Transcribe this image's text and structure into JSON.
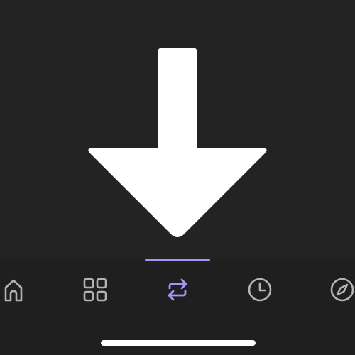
{
  "colors": {
    "background": "#232323",
    "tab_bar_background": "#1f1f1f",
    "accent": "#a596f5",
    "icon_inactive": "#b3b3b3",
    "hero_icon": "#ffffff"
  },
  "hero": {
    "icon": "download-arrow-icon"
  },
  "tab_bar": {
    "active_tab": "transfer",
    "tabs": [
      {
        "id": "home",
        "icon": "home-icon",
        "active": false
      },
      {
        "id": "grid",
        "icon": "grid-icon",
        "active": false
      },
      {
        "id": "transfer",
        "icon": "transfer-arrows-icon",
        "active": true
      },
      {
        "id": "history",
        "icon": "clock-icon",
        "active": false
      },
      {
        "id": "explore",
        "icon": "compass-icon",
        "active": false
      }
    ]
  }
}
